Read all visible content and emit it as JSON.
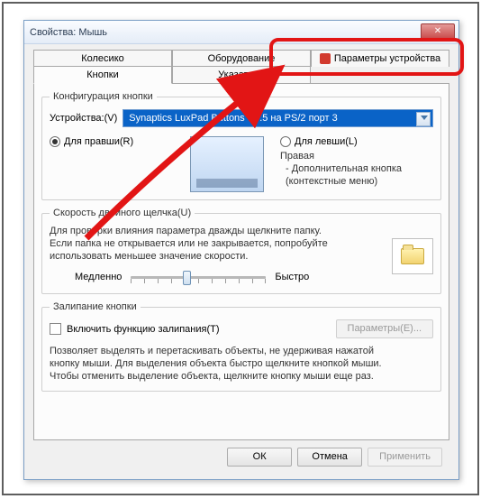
{
  "window": {
    "title": "Свойства: Мышь",
    "close_tooltip": "Закрыть"
  },
  "tabs": {
    "row1": [
      "Колесико",
      "Оборудование"
    ],
    "special": "Параметры устройства",
    "row2": [
      "Кнопки",
      "Указатели"
    ]
  },
  "config": {
    "legend": "Конфигурация кнопки",
    "device_label": "Устройства:(V)",
    "device_value": "Synaptics LuxPad Buttons V7.5 на PS/2 порт 3",
    "radio_right": "Для правши(R)",
    "radio_left": "Для левши(L)",
    "desc_title": "Правая",
    "desc_line1": "- Дополнительная кнопка",
    "desc_line2": "(контекстные меню)"
  },
  "dblclick": {
    "legend": "Скорость двойного щелчка(U)",
    "text1": "Для проверки влияния параметра дважды щелкните папку.",
    "text2": "Если папка не открывается или не закрывается, попробуйте",
    "text3": "использовать меньшее значение скорости.",
    "slow": "Медленно",
    "fast": "Быстро"
  },
  "sticky": {
    "legend": "Залипание кнопки",
    "checkbox": "Включить функцию залипания(T)",
    "params_btn": "Параметры(E)...",
    "desc1": "Позволяет выделять и перетаскивать объекты, не удерживая нажатой",
    "desc2": "кнопку мыши. Для выделения объекта быстро щелкните кнопкой мыши.",
    "desc3": "Чтобы отменить выделение объекта, щелкните кнопку мыши еще раз."
  },
  "buttons": {
    "ok": "ОК",
    "cancel": "Отмена",
    "apply": "Применить"
  }
}
